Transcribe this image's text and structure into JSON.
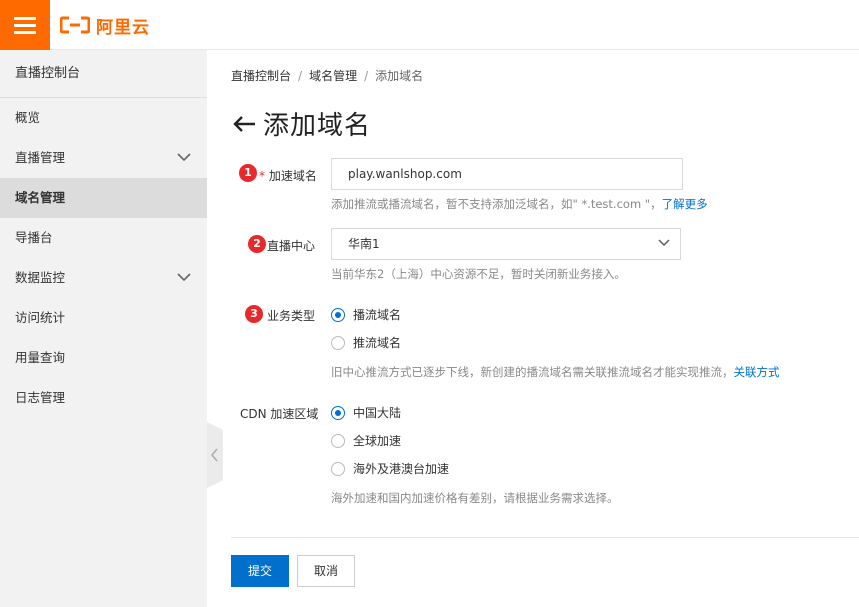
{
  "header": {
    "logo_text": "阿里云",
    "menu_icon": "hamburger-icon",
    "brand_color": "#ff6a00"
  },
  "sidebar": {
    "title": "直播控制台",
    "items": [
      {
        "label": "概览"
      },
      {
        "label": "直播管理"
      },
      {
        "label": "域名管理"
      },
      {
        "label": "导播台"
      },
      {
        "label": "数据监控"
      },
      {
        "label": "访问统计"
      },
      {
        "label": "用量查询"
      },
      {
        "label": "日志管理"
      }
    ]
  },
  "breadcrumb": {
    "item1": "直播控制台",
    "item2": "域名管理",
    "item3": "添加域名",
    "sep": "/"
  },
  "page": {
    "title": "添加域名"
  },
  "form": {
    "domain": {
      "badge": "1",
      "required_mark": "*",
      "label": "加速域名",
      "value": "play.wanlshop.com",
      "help": "添加推流或播流域名，暂不支持添加泛域名，如\" *.test.com \"，",
      "help_link": "了解更多"
    },
    "center": {
      "badge": "2",
      "label": "直播中心",
      "value": "华南1",
      "help": "当前华东2（上海）中心资源不足，暂时关闭新业务接入。"
    },
    "business_type": {
      "badge": "3",
      "label": "业务类型",
      "options": [
        "播流域名",
        "推流域名"
      ],
      "selected": "播流域名",
      "help": "旧中心推流方式已逐步下线，新创建的播流域名需关联推流域名才能实现推流，",
      "help_link": "关联方式"
    },
    "cdn_region": {
      "label": "CDN 加速区域",
      "options": [
        "中国大陆",
        "全球加速",
        "海外及港澳台加速"
      ],
      "selected": "中国大陆",
      "help": "海外加速和国内加速价格有差别，请根据业务需求选择。"
    }
  },
  "actions": {
    "submit": "提交",
    "cancel": "取消"
  },
  "colors": {
    "primary": "#0070cc",
    "badge": "#e8292b"
  }
}
